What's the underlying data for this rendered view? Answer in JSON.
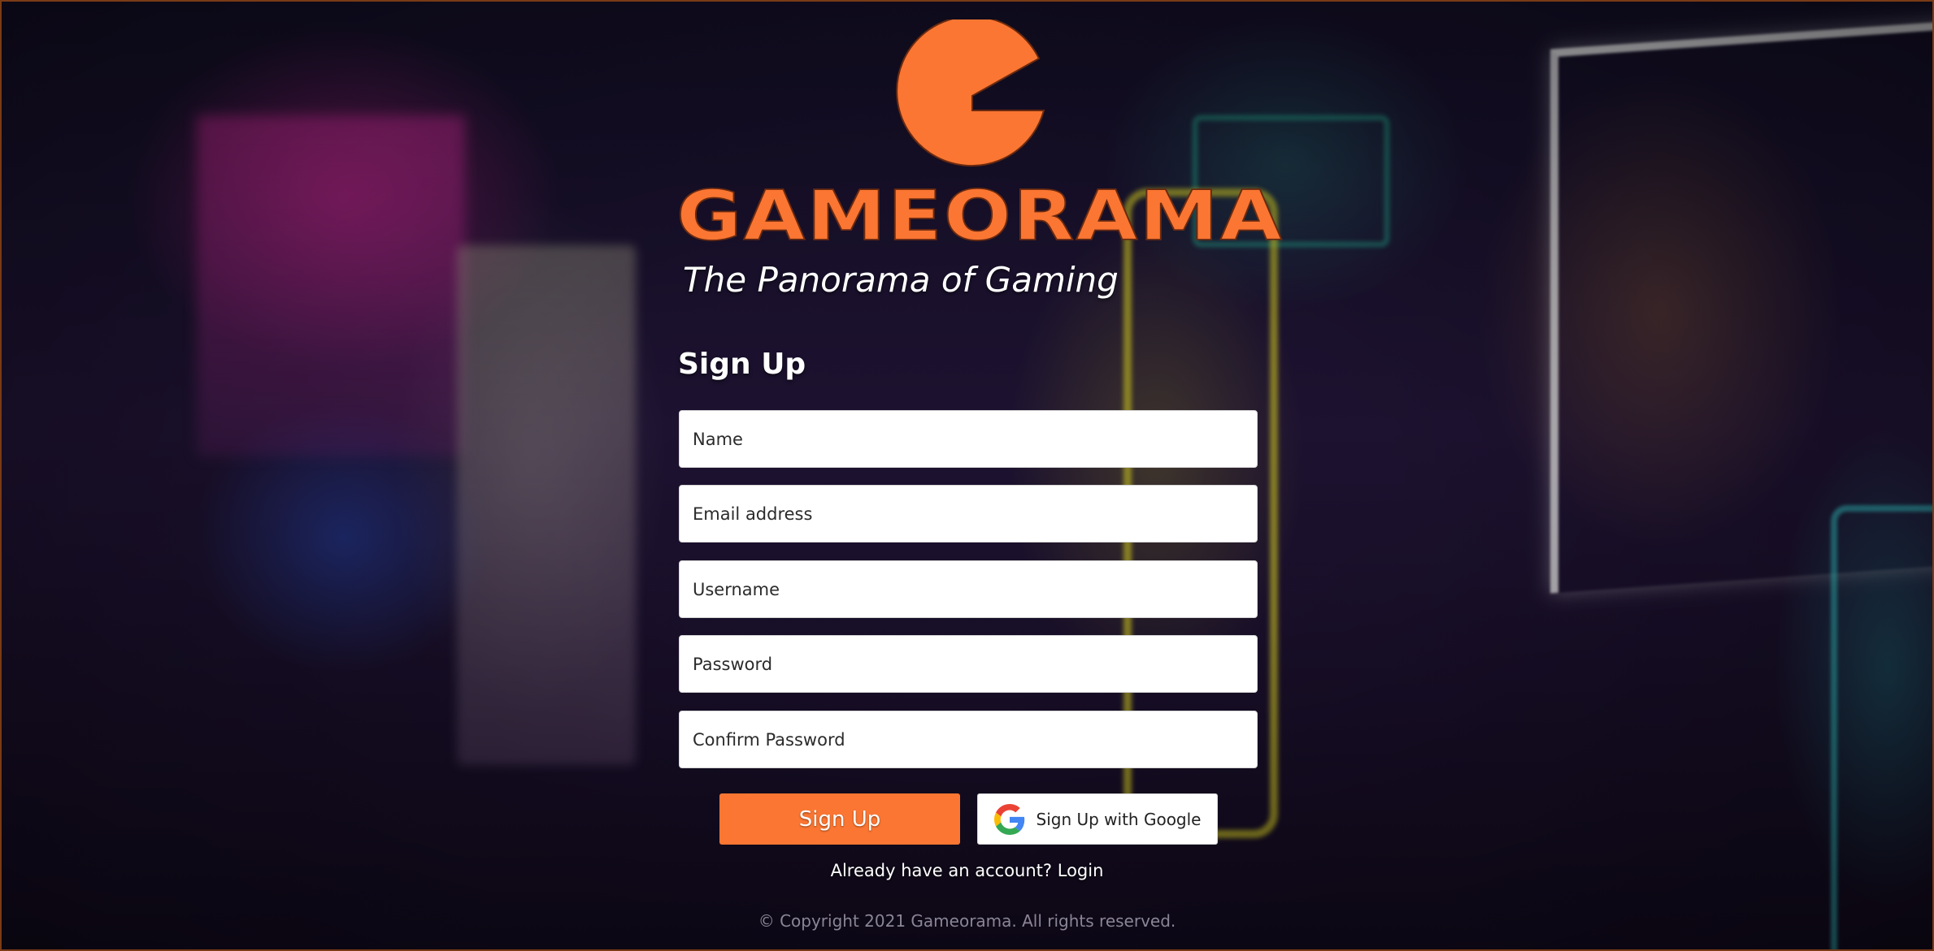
{
  "brand": {
    "name": "GAMEORAMA",
    "tagline": "The Panorama of Gaming",
    "logo_icon": "pac-logo-icon",
    "accent_color": "#fb7632"
  },
  "form": {
    "title": "Sign Up",
    "fields": {
      "name": {
        "placeholder": "Name",
        "value": ""
      },
      "email": {
        "placeholder": "Email address",
        "value": ""
      },
      "username": {
        "placeholder": "Username",
        "value": ""
      },
      "password": {
        "placeholder": "Password",
        "value": ""
      },
      "confirm_password": {
        "placeholder": "Confirm Password",
        "value": ""
      }
    },
    "submit_label": "Sign Up",
    "google_label": "Sign Up with Google",
    "google_icon": "google-icon"
  },
  "login_prompt": {
    "text": "Already have an account?",
    "link_label": "Login"
  },
  "footer": {
    "copyright": "© Copyright 2021 Gameorama. All rights reserved."
  }
}
